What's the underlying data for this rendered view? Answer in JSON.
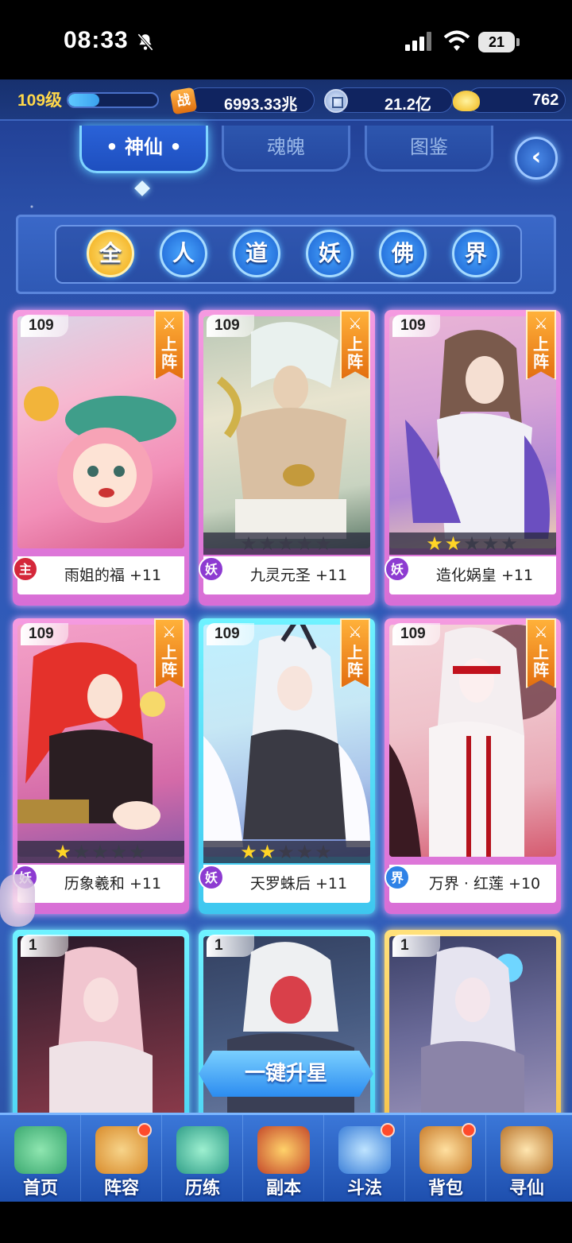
{
  "status": {
    "time": "08:33",
    "battery": "21"
  },
  "resources": {
    "level": "109级",
    "level_progress": 0.35,
    "power_icon_text": "战",
    "power": "6993.33兆",
    "silver": "21.2亿",
    "gold": "762"
  },
  "tabs": [
    {
      "label": "• 神仙 •",
      "active": true
    },
    {
      "label": "魂魄",
      "active": false
    },
    {
      "label": "图鉴",
      "active": false
    }
  ],
  "filters": [
    {
      "label": "全",
      "active": true
    },
    {
      "label": "人",
      "active": false
    },
    {
      "label": "道",
      "active": false
    },
    {
      "label": "妖",
      "active": false
    },
    {
      "label": "佛",
      "active": false
    },
    {
      "label": "界",
      "active": false
    }
  ],
  "cards": [
    {
      "level": "109",
      "deploy": "上阵",
      "name": "雨姐的福 +11",
      "faction": "主",
      "stars": 0,
      "show_stars": false
    },
    {
      "level": "109",
      "deploy": "上阵",
      "name": "九灵元圣 +11",
      "faction": "妖",
      "stars": 0,
      "show_stars": true
    },
    {
      "level": "109",
      "deploy": "上阵",
      "name": "造化娲皇 +11",
      "faction": "妖",
      "stars": 2,
      "show_stars": true
    },
    {
      "level": "109",
      "deploy": "上阵",
      "name": "历象羲和 +11",
      "faction": "妖",
      "stars": 1,
      "show_stars": true
    },
    {
      "level": "109",
      "deploy": "上阵",
      "name": "天罗蛛后 +11",
      "faction": "妖",
      "stars": 2,
      "show_stars": true
    },
    {
      "level": "109",
      "deploy": "上阵",
      "name": "万界 · 红莲 +10",
      "faction": "界",
      "stars": 0,
      "show_stars": false
    },
    {
      "level": "1"
    },
    {
      "level": "1"
    },
    {
      "level": "1"
    }
  ],
  "upgrade_button": "一键升星",
  "nav": [
    {
      "label": "首页",
      "badge": false
    },
    {
      "label": "阵容",
      "badge": true
    },
    {
      "label": "历练",
      "badge": false
    },
    {
      "label": "副本",
      "badge": false
    },
    {
      "label": "斗法",
      "badge": true
    },
    {
      "label": "背包",
      "badge": true
    },
    {
      "label": "寻仙",
      "badge": false
    }
  ]
}
